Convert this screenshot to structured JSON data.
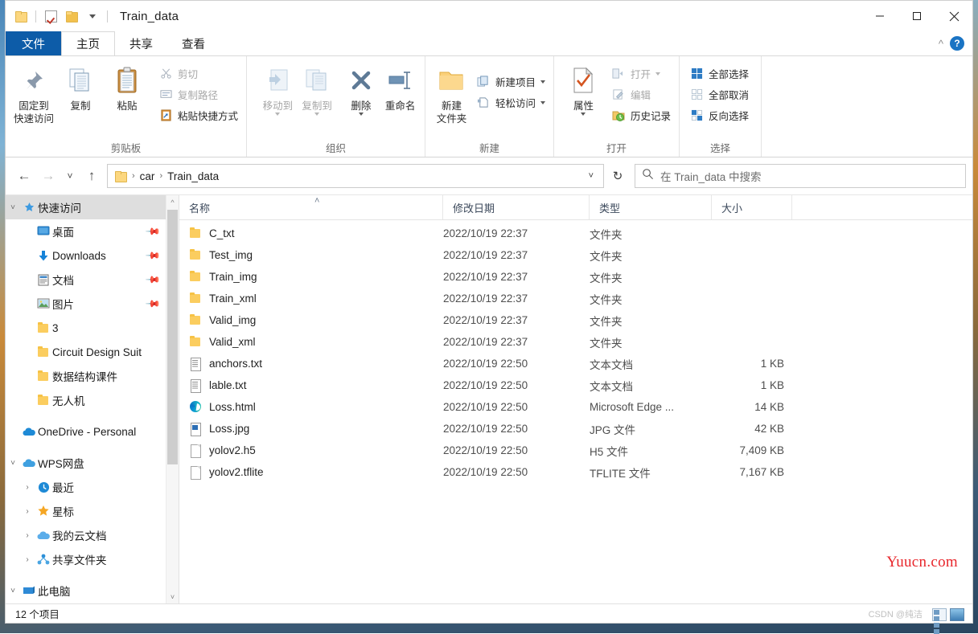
{
  "window": {
    "title": "Train_data",
    "minimize_label": "最小化",
    "maximize_label": "最大化",
    "close_label": "关闭"
  },
  "quick_access_toolbar": {
    "items": [
      {
        "name": "properties-folder",
        "label": "属性"
      },
      {
        "name": "checkbox",
        "label": "选择"
      },
      {
        "name": "new-folder",
        "label": "新建文件夹"
      },
      {
        "name": "customize",
        "label": "自定义快速访问工具栏"
      }
    ]
  },
  "tabs": {
    "file": "文件",
    "items": [
      {
        "label": "主页",
        "active": true
      },
      {
        "label": "共享",
        "active": false
      },
      {
        "label": "查看",
        "active": false
      }
    ],
    "collapse_icon": "chevron-up-icon",
    "help_label": "?"
  },
  "ribbon": {
    "groups": [
      {
        "label": "剪贴板",
        "big_buttons": [
          {
            "label_line1": "固定到",
            "label_line2": "快速访问",
            "icon": "pin-icon",
            "dim": false
          },
          {
            "label_line1": "复制",
            "label_line2": "",
            "icon": "copy-icon",
            "dim": false
          },
          {
            "label_line1": "粘贴",
            "label_line2": "",
            "icon": "paste-icon",
            "dim": false
          }
        ],
        "small_buttons": [
          {
            "label": "剪切",
            "icon": "scissors-icon",
            "dim": true
          },
          {
            "label": "复制路径",
            "icon": "copy-path-icon",
            "dim": true
          },
          {
            "label": "粘贴快捷方式",
            "icon": "paste-shortcut-icon",
            "dim": false
          }
        ]
      },
      {
        "label": "组织",
        "big_buttons": [
          {
            "label_line1": "移动到",
            "label_line2": "",
            "icon": "move-to-icon",
            "dim": true,
            "dropdown": true
          },
          {
            "label_line1": "复制到",
            "label_line2": "",
            "icon": "copy-to-icon",
            "dim": true,
            "dropdown": true
          },
          {
            "label_line1": "删除",
            "label_line2": "",
            "icon": "delete-x-icon",
            "dim": false,
            "dropdown": true
          },
          {
            "label_line1": "重命名",
            "label_line2": "",
            "icon": "rename-icon",
            "dim": false
          }
        ],
        "small_buttons": []
      },
      {
        "label": "新建",
        "big_buttons": [
          {
            "label_line1": "新建",
            "label_line2": "文件夹",
            "icon": "new-folder-icon",
            "dim": false
          }
        ],
        "small_buttons": [
          {
            "label": "新建项目",
            "icon": "new-item-icon",
            "dim": false,
            "dropdown": true
          },
          {
            "label": "轻松访问",
            "icon": "easy-access-icon",
            "dim": false,
            "dropdown": true
          }
        ]
      },
      {
        "label": "打开",
        "big_buttons": [
          {
            "label_line1": "属性",
            "label_line2": "",
            "icon": "properties-icon",
            "dim": false,
            "dropdown": true
          }
        ],
        "small_buttons": [
          {
            "label": "打开",
            "icon": "open-icon",
            "dim": true,
            "dropdown": true
          },
          {
            "label": "编辑",
            "icon": "edit-icon",
            "dim": true
          },
          {
            "label": "历史记录",
            "icon": "history-icon",
            "dim": false
          }
        ]
      },
      {
        "label": "选择",
        "big_buttons": [],
        "small_buttons": [
          {
            "label": "全部选择",
            "icon": "select-all-icon",
            "dim": false
          },
          {
            "label": "全部取消",
            "icon": "select-none-icon",
            "dim": false
          },
          {
            "label": "反向选择",
            "icon": "invert-selection-icon",
            "dim": false
          }
        ]
      }
    ]
  },
  "navigation": {
    "back_label": "后退",
    "forward_label": "前进",
    "recent_label": "最近浏览的位置",
    "up_label": "上移到",
    "refresh_label": "刷新",
    "breadcrumb": [
      "car",
      "Train_data"
    ],
    "breadcrumb_separator": "›",
    "search": {
      "placeholder": "在 Train_data 中搜索",
      "value": "",
      "icon": "search-icon"
    }
  },
  "sidebar": {
    "items": [
      {
        "label": "快速访问",
        "icon": "star-pin-icon",
        "indent": 0,
        "expander": "chevron-down",
        "selected": true,
        "pinned": false
      },
      {
        "label": "桌面",
        "icon": "desktop-icon",
        "indent": 1,
        "expander": "",
        "selected": false,
        "pinned": true
      },
      {
        "label": "Downloads",
        "icon": "download-icon",
        "indent": 1,
        "expander": "",
        "selected": false,
        "pinned": true
      },
      {
        "label": "文档",
        "icon": "documents-icon",
        "indent": 1,
        "expander": "",
        "selected": false,
        "pinned": true
      },
      {
        "label": "图片",
        "icon": "pictures-icon",
        "indent": 1,
        "expander": "",
        "selected": false,
        "pinned": true
      },
      {
        "label": "3",
        "icon": "folder-icon",
        "indent": 1,
        "expander": "",
        "selected": false,
        "pinned": false
      },
      {
        "label": "Circuit Design Suit",
        "icon": "folder-icon",
        "indent": 1,
        "expander": "",
        "selected": false,
        "pinned": false
      },
      {
        "label": "数据结构课件",
        "icon": "folder-icon",
        "indent": 1,
        "expander": "",
        "selected": false,
        "pinned": false
      },
      {
        "label": "无人机",
        "icon": "folder-icon",
        "indent": 1,
        "expander": "",
        "selected": false,
        "pinned": false
      },
      {
        "label": "OneDrive - Personal",
        "icon": "onedrive-icon",
        "indent": 0,
        "expander": "",
        "selected": false,
        "pinned": false
      },
      {
        "label": "WPS网盘",
        "icon": "wps-cloud-icon",
        "indent": 0,
        "expander": "chevron-down",
        "selected": false,
        "pinned": false
      },
      {
        "label": "最近",
        "icon": "clock-icon",
        "indent": 1,
        "expander": "chevron-right",
        "selected": false,
        "pinned": false
      },
      {
        "label": "星标",
        "icon": "star-icon",
        "indent": 1,
        "expander": "chevron-right",
        "selected": false,
        "pinned": false
      },
      {
        "label": "我的云文档",
        "icon": "cloud-doc-icon",
        "indent": 1,
        "expander": "chevron-right",
        "selected": false,
        "pinned": false
      },
      {
        "label": "共享文件夹",
        "icon": "shared-folder-icon",
        "indent": 1,
        "expander": "chevron-right",
        "selected": false,
        "pinned": false
      },
      {
        "label": "此电脑",
        "icon": "this-pc-icon",
        "indent": 0,
        "expander": "chevron-down",
        "selected": false,
        "pinned": false
      }
    ],
    "scrollbar": {
      "up_arrow": "˄",
      "down_arrow": "˅"
    }
  },
  "file_list": {
    "columns": [
      {
        "key": "name",
        "label": "名称",
        "sorted": "asc"
      },
      {
        "key": "date",
        "label": "修改日期",
        "sorted": ""
      },
      {
        "key": "type",
        "label": "类型",
        "sorted": ""
      },
      {
        "key": "size",
        "label": "大小",
        "sorted": ""
      }
    ],
    "sort_indicator": "˄",
    "rows": [
      {
        "name": "C_txt",
        "date": "2022/10/19 22:37",
        "type": "文件夹",
        "size": "",
        "icon": "folder-icon"
      },
      {
        "name": "Test_img",
        "date": "2022/10/19 22:37",
        "type": "文件夹",
        "size": "",
        "icon": "folder-icon"
      },
      {
        "name": "Train_img",
        "date": "2022/10/19 22:37",
        "type": "文件夹",
        "size": "",
        "icon": "folder-icon"
      },
      {
        "name": "Train_xml",
        "date": "2022/10/19 22:37",
        "type": "文件夹",
        "size": "",
        "icon": "folder-icon"
      },
      {
        "name": "Valid_img",
        "date": "2022/10/19 22:37",
        "type": "文件夹",
        "size": "",
        "icon": "folder-icon"
      },
      {
        "name": "Valid_xml",
        "date": "2022/10/19 22:37",
        "type": "文件夹",
        "size": "",
        "icon": "folder-icon"
      },
      {
        "name": "anchors.txt",
        "date": "2022/10/19 22:50",
        "type": "文本文档",
        "size": "1 KB",
        "icon": "text-file-icon"
      },
      {
        "name": "lable.txt",
        "date": "2022/10/19 22:50",
        "type": "文本文档",
        "size": "1 KB",
        "icon": "text-file-icon"
      },
      {
        "name": "Loss.html",
        "date": "2022/10/19 22:50",
        "type": "Microsoft Edge ...",
        "size": "14 KB",
        "icon": "edge-icon"
      },
      {
        "name": "Loss.jpg",
        "date": "2022/10/19 22:50",
        "type": "JPG 文件",
        "size": "42 KB",
        "icon": "jpg-file-icon"
      },
      {
        "name": "yolov2.h5",
        "date": "2022/10/19 22:50",
        "type": "H5 文件",
        "size": "7,409 KB",
        "icon": "generic-file-icon"
      },
      {
        "name": "yolov2.tflite",
        "date": "2022/10/19 22:50",
        "type": "TFLITE 文件",
        "size": "7,167 KB",
        "icon": "generic-file-icon"
      }
    ]
  },
  "status_bar": {
    "item_count": "12 个项目",
    "view_details_label": "详细信息",
    "view_large_icons_label": "大图标"
  },
  "watermarks": {
    "primary": "Yuucn.com",
    "secondary": "CSDN @纯洁",
    "primary_color": "#e8262b"
  }
}
